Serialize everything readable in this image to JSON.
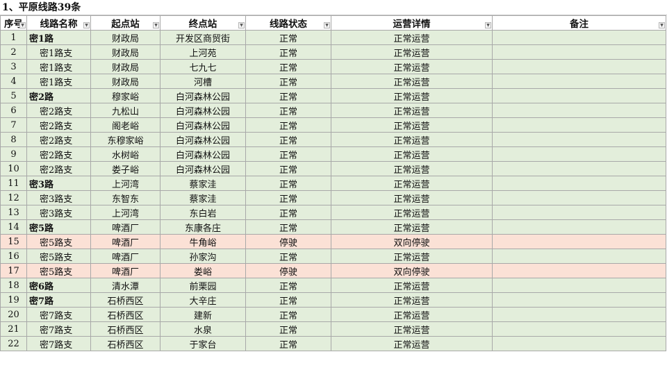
{
  "sheet_title": "1、平原线路39条",
  "headers": [
    "序号",
    "线路名称",
    "起点站",
    "终点站",
    "线路状态",
    "运营详情",
    "备注"
  ],
  "colors": {
    "normal_row": "#e3eedb",
    "stopped_row": "#fbe1d6"
  },
  "rows": [
    {
      "no": "1",
      "name": "密1路",
      "main": true,
      "from": "财政局",
      "to": "开发区商贸街",
      "status": "正常",
      "detail": "正常运营",
      "note": "",
      "stopped": false
    },
    {
      "no": "2",
      "name": "密1路支",
      "main": false,
      "from": "财政局",
      "to": "上河苑",
      "status": "正常",
      "detail": "正常运营",
      "note": "",
      "stopped": false
    },
    {
      "no": "3",
      "name": "密1路支",
      "main": false,
      "from": "财政局",
      "to": "七九七",
      "status": "正常",
      "detail": "正常运营",
      "note": "",
      "stopped": false
    },
    {
      "no": "4",
      "name": "密1路支",
      "main": false,
      "from": "财政局",
      "to": "河槽",
      "status": "正常",
      "detail": "正常运营",
      "note": "",
      "stopped": false
    },
    {
      "no": "5",
      "name": "密2路",
      "main": true,
      "from": "穆家峪",
      "to": "白河森林公园",
      "status": "正常",
      "detail": "正常运营",
      "note": "",
      "stopped": false
    },
    {
      "no": "6",
      "name": "密2路支",
      "main": false,
      "from": "九松山",
      "to": "白河森林公园",
      "status": "正常",
      "detail": "正常运营",
      "note": "",
      "stopped": false
    },
    {
      "no": "7",
      "name": "密2路支",
      "main": false,
      "from": "阁老峪",
      "to": "白河森林公园",
      "status": "正常",
      "detail": "正常运营",
      "note": "",
      "stopped": false
    },
    {
      "no": "8",
      "name": "密2路支",
      "main": false,
      "from": "东穆家峪",
      "to": "白河森林公园",
      "status": "正常",
      "detail": "正常运营",
      "note": "",
      "stopped": false
    },
    {
      "no": "9",
      "name": "密2路支",
      "main": false,
      "from": "水树峪",
      "to": "白河森林公园",
      "status": "正常",
      "detail": "正常运营",
      "note": "",
      "stopped": false
    },
    {
      "no": "10",
      "name": "密2路支",
      "main": false,
      "from": "娄子峪",
      "to": "白河森林公园",
      "status": "正常",
      "detail": "正常运营",
      "note": "",
      "stopped": false
    },
    {
      "no": "11",
      "name": "密3路",
      "main": true,
      "from": "上河湾",
      "to": "蔡家洼",
      "status": "正常",
      "detail": "正常运营",
      "note": "",
      "stopped": false
    },
    {
      "no": "12",
      "name": "密3路支",
      "main": false,
      "from": "东智东",
      "to": "蔡家洼",
      "status": "正常",
      "detail": "正常运营",
      "note": "",
      "stopped": false
    },
    {
      "no": "13",
      "name": "密3路支",
      "main": false,
      "from": "上河湾",
      "to": "东白岩",
      "status": "正常",
      "detail": "正常运营",
      "note": "",
      "stopped": false
    },
    {
      "no": "14",
      "name": "密5路",
      "main": true,
      "from": "啤酒厂",
      "to": "东康各庄",
      "status": "正常",
      "detail": "正常运营",
      "note": "",
      "stopped": false
    },
    {
      "no": "15",
      "name": "密5路支",
      "main": false,
      "from": "啤酒厂",
      "to": "牛角峪",
      "status": "停驶",
      "detail": "双向停驶",
      "note": "",
      "stopped": true
    },
    {
      "no": "16",
      "name": "密5路支",
      "main": false,
      "from": "啤酒厂",
      "to": "孙家沟",
      "status": "正常",
      "detail": "正常运营",
      "note": "",
      "stopped": false
    },
    {
      "no": "17",
      "name": "密5路支",
      "main": false,
      "from": "啤酒厂",
      "to": "娄峪",
      "status": "停驶",
      "detail": "双向停驶",
      "note": "",
      "stopped": true
    },
    {
      "no": "18",
      "name": "密6路",
      "main": true,
      "from": "清水潭",
      "to": "前栗园",
      "status": "正常",
      "detail": "正常运营",
      "note": "",
      "stopped": false
    },
    {
      "no": "19",
      "name": "密7路",
      "main": true,
      "from": "石桥西区",
      "to": "大辛庄",
      "status": "正常",
      "detail": "正常运营",
      "note": "",
      "stopped": false
    },
    {
      "no": "20",
      "name": "密7路支",
      "main": false,
      "from": "石桥西区",
      "to": "建新",
      "status": "正常",
      "detail": "正常运营",
      "note": "",
      "stopped": false
    },
    {
      "no": "21",
      "name": "密7路支",
      "main": false,
      "from": "石桥西区",
      "to": "水泉",
      "status": "正常",
      "detail": "正常运营",
      "note": "",
      "stopped": false
    },
    {
      "no": "22",
      "name": "密7路支",
      "main": false,
      "from": "石桥西区",
      "to": "于家台",
      "status": "正常",
      "detail": "正常运营",
      "note": "",
      "stopped": false
    }
  ]
}
